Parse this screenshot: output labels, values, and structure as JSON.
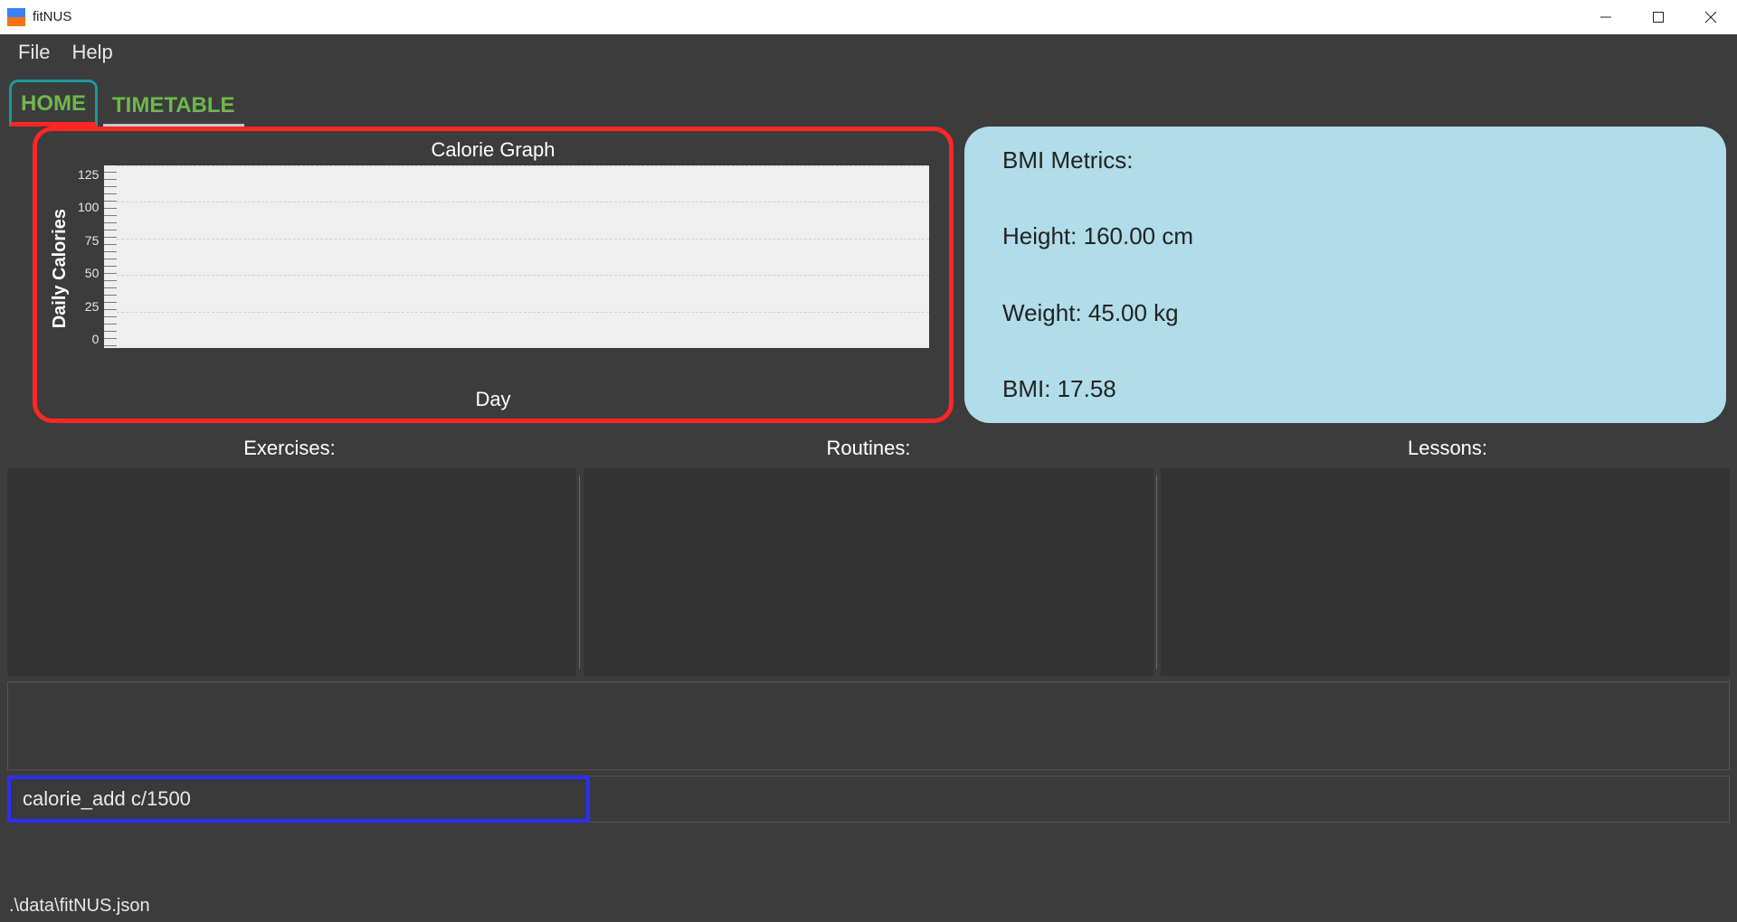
{
  "window": {
    "title": "fitNUS"
  },
  "menubar": {
    "items": [
      "File",
      "Help"
    ]
  },
  "tabs": [
    {
      "label": "HOME",
      "active": true
    },
    {
      "label": "TIMETABLE",
      "active": false
    }
  ],
  "chart_data": {
    "type": "bar",
    "title": "Calorie Graph",
    "xlabel": "Day",
    "ylabel": "Daily Calories",
    "yticks": [
      125,
      100,
      75,
      50,
      25,
      0
    ],
    "ylim": [
      0,
      125
    ],
    "categories": [],
    "values": []
  },
  "bmi": {
    "heading": "BMI Metrics:",
    "height_label": "Height: 160.00 cm",
    "weight_label": "Weight: 45.00 kg",
    "bmi_label": "BMI: 17.58",
    "height_cm": 160.0,
    "weight_kg": 45.0,
    "bmi_value": 17.58
  },
  "columns": {
    "exercises": {
      "heading": "Exercises:",
      "items": []
    },
    "routines": {
      "heading": "Routines:",
      "items": []
    },
    "lessons": {
      "heading": "Lessons:",
      "items": []
    }
  },
  "output": {
    "text": ""
  },
  "command": {
    "value": "calorie_add c/1500"
  },
  "status": {
    "path": ".\\data\\fitNUS.json"
  }
}
